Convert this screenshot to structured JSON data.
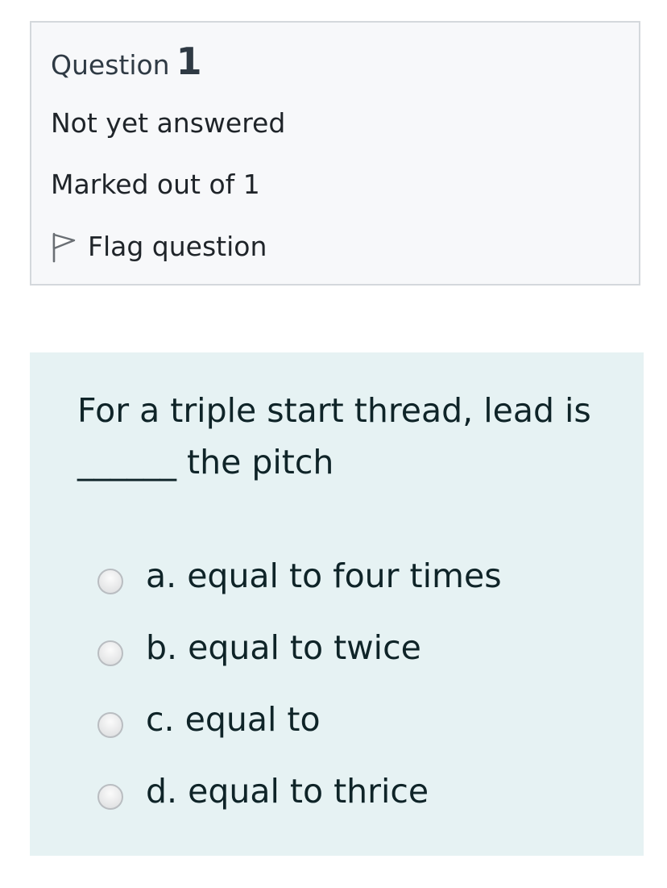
{
  "info": {
    "question_label": "Question",
    "question_number": "1",
    "state": "Not yet answered",
    "mark": "Marked out of 1",
    "flag_icon": "flag-icon",
    "flag_label": "Flag question"
  },
  "question": {
    "text": "For a triple start thread, lead is ______ the pitch",
    "answers": [
      {
        "label": "a. equal to four times",
        "selected": false
      },
      {
        "label": "b. equal to twice",
        "selected": false
      },
      {
        "label": "c. equal to",
        "selected": false
      },
      {
        "label": "d. equal to thrice",
        "selected": false
      }
    ]
  },
  "colors": {
    "info_background": "#f7f8fa",
    "info_border": "#d4d8dc",
    "question_background": "#e6f2f3",
    "text": "#0f2428"
  }
}
